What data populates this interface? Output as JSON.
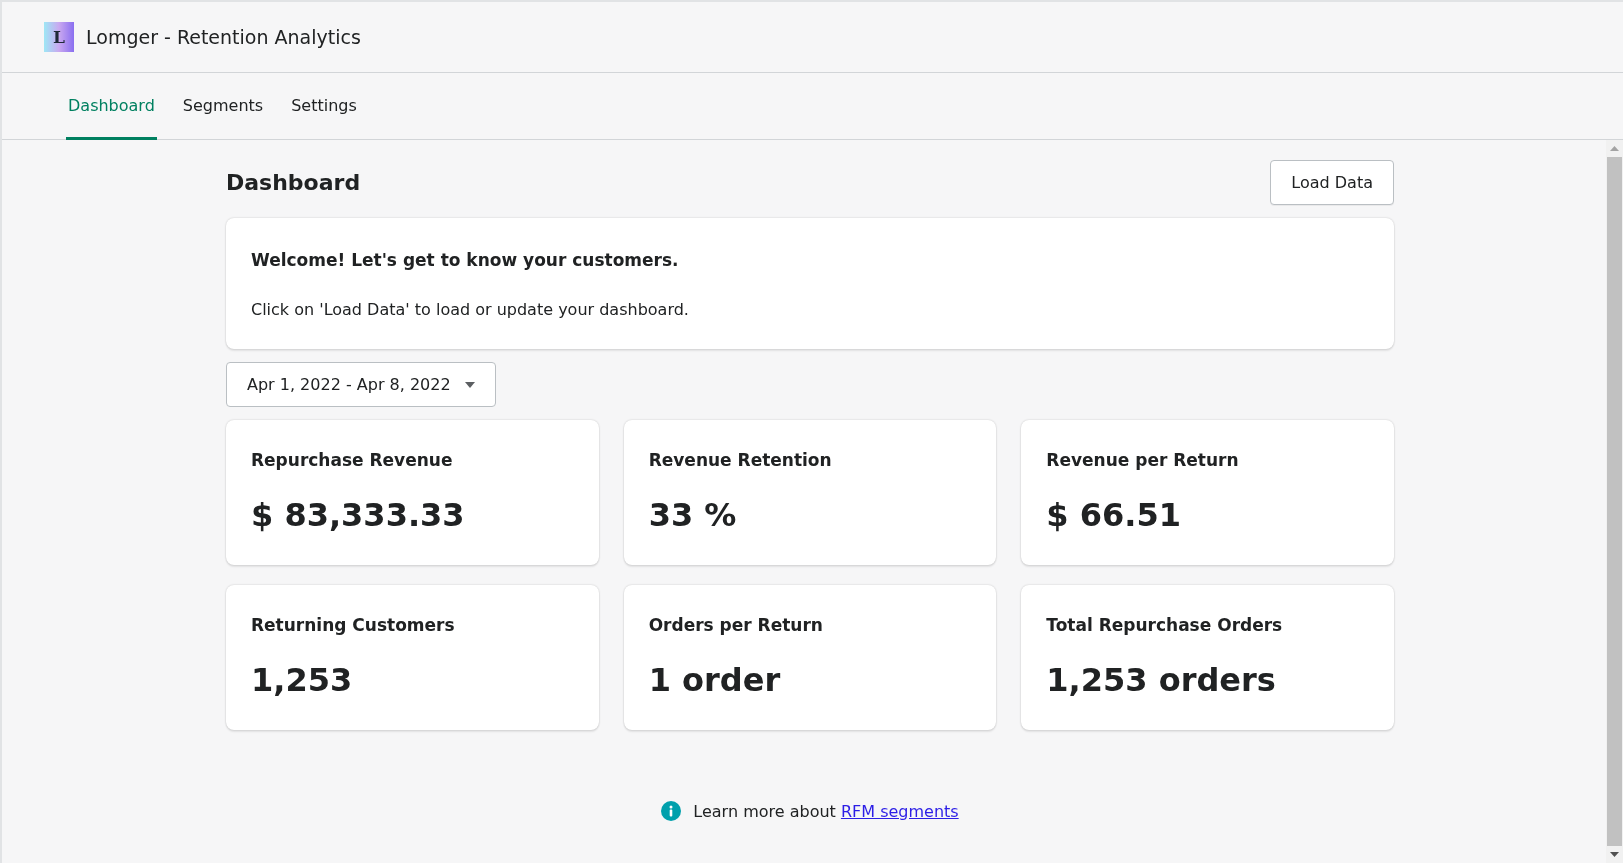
{
  "app": {
    "logo_letter": "L",
    "title": "Lomger - Retention Analytics"
  },
  "tabs": [
    {
      "label": "Dashboard",
      "selected": true
    },
    {
      "label": "Segments",
      "selected": false
    },
    {
      "label": "Settings",
      "selected": false
    }
  ],
  "page": {
    "title": "Dashboard",
    "action": "Load Data"
  },
  "welcome": {
    "heading": "Welcome! Let's get to know your customers.",
    "body": "Click on 'Load Data' to load or update your dashboard."
  },
  "date_range": "Apr 1, 2022 - Apr 8, 2022",
  "metrics": [
    {
      "label": "Repurchase Revenue",
      "value": "$ 83,333.33"
    },
    {
      "label": "Revenue Retention",
      "value": "33 %"
    },
    {
      "label": "Revenue per Return",
      "value": "$ 66.51"
    },
    {
      "label": "Returning Customers",
      "value": "1,253"
    },
    {
      "label": "Orders per Return",
      "value": "1 order"
    },
    {
      "label": "Total Repurchase Orders",
      "value": "1,253 orders"
    }
  ],
  "footer": {
    "text": "Learn more about",
    "link": "RFM segments"
  }
}
